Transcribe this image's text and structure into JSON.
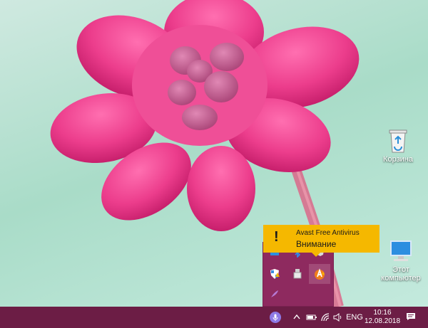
{
  "desktop": {
    "icons": [
      {
        "label": "Корзина",
        "icon": "recycle-bin-icon"
      },
      {
        "label_line1": "Этот",
        "label_line2": "компьютер",
        "icon": "this-pc-icon"
      }
    ]
  },
  "toast": {
    "app_name": "Avast Free Antivirus",
    "message": "Внимание",
    "icon": "exclamation-icon",
    "background": "#f5b800"
  },
  "tray_overflow": {
    "icons": [
      "windows-update-icon",
      "bluetooth-icon",
      "shield-warning-icon",
      "security-center-icon",
      "usb-device-icon",
      "avast-icon",
      "feather-icon"
    ]
  },
  "taskbar": {
    "language": "ENG",
    "time": "10:16",
    "date": "12.08.2018",
    "color": "#6c1d45"
  }
}
